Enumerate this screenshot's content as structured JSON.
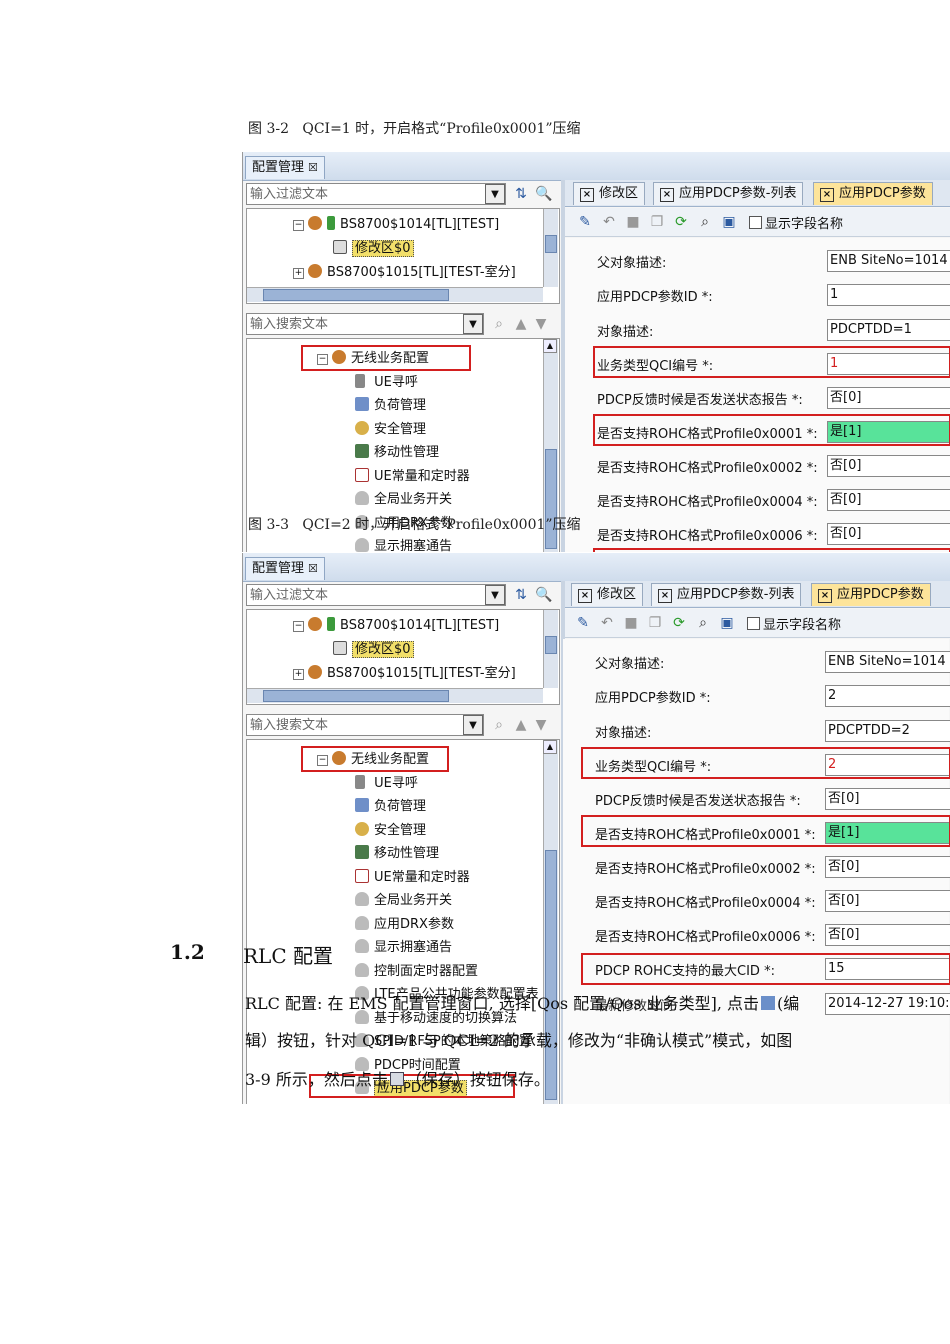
{
  "fig1": {
    "caption_label": "图 3-2",
    "caption_text": "QCI=1 时，开启格式“Profile0x0001”压缩",
    "window_tab": "配置管理",
    "filter_placeholder": "输入过滤文本",
    "search_placeholder": "输入搜索文本",
    "top_tree": [
      {
        "label": "BS8700$1014[TL][TEST]"
      },
      {
        "label": "修改区$0"
      },
      {
        "label": "BS8700$1015[TL][TEST-室分]"
      }
    ],
    "tree": [
      "无线业务配置",
      "UE寻呼",
      "负荷管理",
      "安全管理",
      "移动性管理",
      "UE常量和定时器",
      "全局业务开关",
      "应用DRX参数",
      "显示拥塞通告"
    ],
    "tabs": [
      "修改区",
      "应用PDCP参数-列表",
      "应用PDCP参数"
    ],
    "show_field_name": "显示字段名称",
    "form": [
      {
        "label": "父对象描述:",
        "value": "ENB SiteNo=1014"
      },
      {
        "label": "应用PDCP参数ID *:",
        "value": "1"
      },
      {
        "label": "对象描述:",
        "value": "PDCPTDD=1"
      },
      {
        "label": "业务类型QCI编号 *:",
        "value": "1"
      },
      {
        "label": "PDCP反馈时候是否发送状态报告 *:",
        "value": "否[0]"
      },
      {
        "label": "是否支持ROHC格式Profile0x0001 *:",
        "value": "是[1]"
      },
      {
        "label": "是否支持ROHC格式Profile0x0002 *:",
        "value": "否[0]"
      },
      {
        "label": "是否支持ROHC格式Profile0x0004 *:",
        "value": "否[0]"
      },
      {
        "label": "是否支持ROHC格式Profile0x0006 *:",
        "value": "否[0]"
      }
    ]
  },
  "fig2": {
    "caption_label": "图 3-3",
    "caption_text": "QCI=2 时，开启格式“Profile0x0001”压缩",
    "window_tab": "配置管理",
    "filter_placeholder": "输入过滤文本",
    "search_placeholder": "输入搜索文本",
    "top_tree": [
      {
        "label": "BS8700$1014[TL][TEST]"
      },
      {
        "label": "修改区$0"
      },
      {
        "label": "BS8700$1015[TL][TEST-室分]"
      }
    ],
    "tree": [
      "无线业务配置",
      "UE寻呼",
      "负荷管理",
      "安全管理",
      "移动性管理",
      "UE常量和定时器",
      "全局业务开关",
      "应用DRX参数",
      "显示拥塞通告",
      "控制面定时器配置",
      "LTE产品公共功能参数配置表",
      "基于移动速度的切换算法",
      "SPID/RFSP的本地策略配置",
      "PDCP时间配置",
      "应用PDCP参数"
    ],
    "tabs": [
      "修改区",
      "应用PDCP参数-列表",
      "应用PDCP参数"
    ],
    "show_field_name": "显示字段名称",
    "form": [
      {
        "label": "父对象描述:",
        "value": "ENB SiteNo=1014"
      },
      {
        "label": "应用PDCP参数ID *:",
        "value": "2"
      },
      {
        "label": "对象描述:",
        "value": "PDCPTDD=2"
      },
      {
        "label": "业务类型QCI编号 *:",
        "value": "2"
      },
      {
        "label": "PDCP反馈时候是否发送状态报告 *:",
        "value": "否[0]"
      },
      {
        "label": "是否支持ROHC格式Profile0x0001 *:",
        "value": "是[1]"
      },
      {
        "label": "是否支持ROHC格式Profile0x0002 *:",
        "value": "否[0]"
      },
      {
        "label": "是否支持ROHC格式Profile0x0004 *:",
        "value": "否[0]"
      },
      {
        "label": "是否支持ROHC格式Profile0x0006 *:",
        "value": "否[0]"
      },
      {
        "label": "PDCP ROHC支持的最大CID *:",
        "value": "15"
      },
      {
        "label": "最新修改时间:",
        "value": "2014-12-27 19:10:17"
      }
    ]
  },
  "section": {
    "number": "1.2",
    "title": "RLC 配置",
    "para_line1": "RLC 配置: 在 EMS 配置管理窗口, 选择[Qos 配置/Qos 业务类型], 点击",
    "para_edit": "(编",
    "para_line2": "辑）按钮，针对 QCI=1 与 QCI=2 的承载，修改为“非确认模式”模式，如图",
    "para_line3": "3-9 所示，然后点击",
    "para_save": "（保存）按钮保存。"
  }
}
